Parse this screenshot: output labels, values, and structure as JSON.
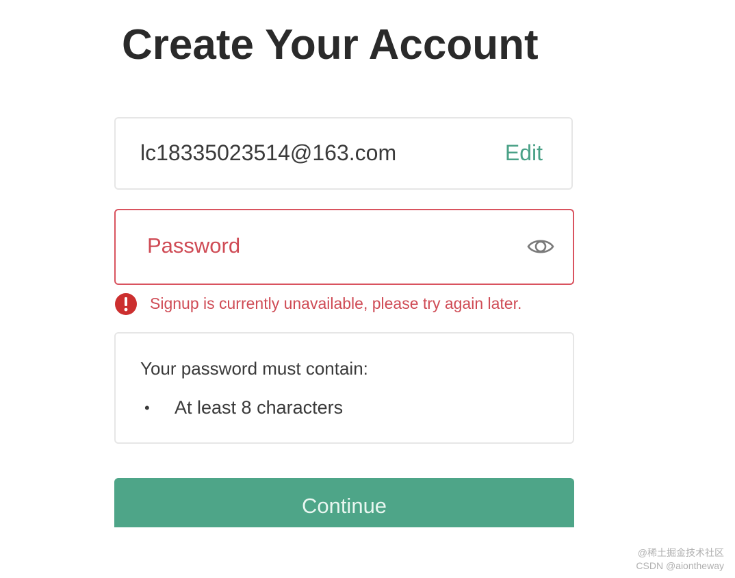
{
  "title": "Create Your Account",
  "email": {
    "value": "lc18335023514@163.com",
    "edit_label": "Edit"
  },
  "password": {
    "placeholder": "Password",
    "value": "",
    "toggle_icon": "eye-icon"
  },
  "error": {
    "icon": "alert-icon",
    "message": "Signup is currently unavailable, please try again later."
  },
  "requirements": {
    "heading": "Your password must contain:",
    "items": [
      {
        "bullet": "•",
        "text": "At least 8 characters"
      }
    ]
  },
  "continue_label": "Continue",
  "watermark": {
    "line1": "@稀土掘金技术社区",
    "line2": "CSDN @aiontheway"
  },
  "colors": {
    "accent": "#4ea588",
    "error": "#cf4b55",
    "border": "#e6e6e6"
  }
}
